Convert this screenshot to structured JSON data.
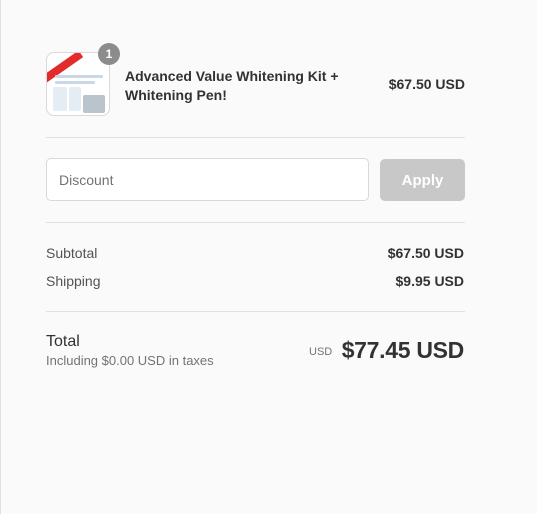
{
  "line_item": {
    "quantity": "1",
    "name_line1": "Advanced Value Whitening Kit +",
    "name_line2": "Whitening Pen!",
    "price": "$67.50 USD"
  },
  "discount": {
    "placeholder": "Discount",
    "value": "",
    "apply_label": "Apply"
  },
  "summary": {
    "subtotal_label": "Subtotal",
    "subtotal_value": "$67.50 USD",
    "shipping_label": "Shipping",
    "shipping_value": "$9.95 USD"
  },
  "total": {
    "label": "Total",
    "tax_note": "Including $0.00 USD in taxes",
    "currency": "USD",
    "amount": "$77.45 USD"
  },
  "colors": {
    "background": "#fafafa",
    "apply_button_disabled": "#c8c8c8",
    "quantity_badge": "#8c8c8c"
  }
}
